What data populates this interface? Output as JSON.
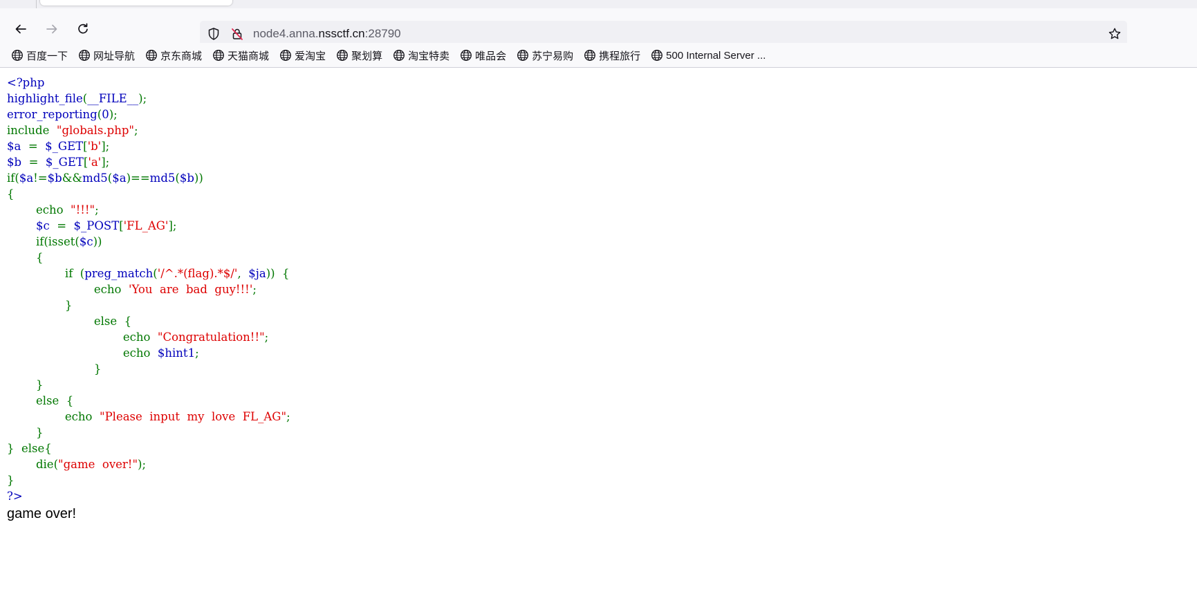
{
  "browser": {
    "url_prefix": "node4.anna.",
    "url_domain": "nssctf.cn",
    "url_suffix": ":28790",
    "icons": {
      "back": "arrow-left-icon",
      "forward": "arrow-right-icon",
      "reload": "reload-icon",
      "tracking": "shield-icon",
      "insecure": "insecure-lock-icon",
      "bookmark": "star-icon",
      "bookmark_item": "globe-icon"
    },
    "bookmarks": [
      "百度一下",
      "网址导航",
      "京东商城",
      "天猫商城",
      "爱淘宝",
      "聚划算",
      "淘宝特卖",
      "唯品会",
      "苏宁易购",
      "携程旅行",
      "500 Internal Server ..."
    ]
  },
  "colors": {
    "php_keyword": "#007700",
    "php_default": "#0000bb",
    "php_string": "#dd0000"
  },
  "code": [
    [
      [
        "d",
        "<?php"
      ]
    ],
    [
      [
        "d",
        "highlight_file"
      ],
      [
        "k",
        "("
      ],
      [
        "d",
        "__FILE__"
      ],
      [
        "k",
        ");"
      ]
    ],
    [
      [
        "d",
        "error_reporting"
      ],
      [
        "k",
        "("
      ],
      [
        "d",
        "0"
      ],
      [
        "k",
        ");"
      ]
    ],
    [
      [
        "k",
        "include  "
      ],
      [
        "s",
        "\"globals.php\""
      ],
      [
        "k",
        ";"
      ]
    ],
    [
      [
        "d",
        "$a  "
      ],
      [
        "k",
        "=  "
      ],
      [
        "d",
        "$_GET"
      ],
      [
        "k",
        "["
      ],
      [
        "s",
        "'b'"
      ],
      [
        "k",
        "];"
      ]
    ],
    [
      [
        "d",
        "$b  "
      ],
      [
        "k",
        "=  "
      ],
      [
        "d",
        "$_GET"
      ],
      [
        "k",
        "["
      ],
      [
        "s",
        "'a'"
      ],
      [
        "k",
        "];"
      ]
    ],
    [
      [
        "k",
        "if("
      ],
      [
        "d",
        "$a"
      ],
      [
        "k",
        "!="
      ],
      [
        "d",
        "$b"
      ],
      [
        "k",
        "&&"
      ],
      [
        "d",
        "md5"
      ],
      [
        "k",
        "("
      ],
      [
        "d",
        "$a"
      ],
      [
        "k",
        ")=="
      ],
      [
        "d",
        "md5"
      ],
      [
        "k",
        "("
      ],
      [
        "d",
        "$b"
      ],
      [
        "k",
        "))"
      ]
    ],
    [
      [
        "k",
        "{"
      ]
    ],
    [
      [
        "k",
        "        echo  "
      ],
      [
        "s",
        "\"!!!\""
      ],
      [
        "k",
        ";"
      ]
    ],
    [
      [
        "d",
        "        $c  "
      ],
      [
        "k",
        "=  "
      ],
      [
        "d",
        "$_POST"
      ],
      [
        "k",
        "["
      ],
      [
        "s",
        "'FL_AG'"
      ],
      [
        "k",
        "];"
      ]
    ],
    [
      [
        "k",
        "        if(isset("
      ],
      [
        "d",
        "$c"
      ],
      [
        "k",
        "))"
      ]
    ],
    [
      [
        "k",
        "        {"
      ]
    ],
    [
      [
        "k",
        "                if  ("
      ],
      [
        "d",
        "preg_match"
      ],
      [
        "k",
        "("
      ],
      [
        "s",
        "'/^.*(flag).*$/'"
      ],
      [
        "k",
        ",  "
      ],
      [
        "d",
        "$ja"
      ],
      [
        "k",
        "))  {"
      ]
    ],
    [
      [
        "k",
        "                        echo  "
      ],
      [
        "s",
        "'You  are  bad  guy!!!'"
      ],
      [
        "k",
        ";"
      ]
    ],
    [
      [
        "k",
        "                }"
      ]
    ],
    [
      [
        "k",
        "                        else  {"
      ]
    ],
    [
      [
        "k",
        "                                echo  "
      ],
      [
        "s",
        "\"Congratulation!!\""
      ],
      [
        "k",
        ";"
      ]
    ],
    [
      [
        "k",
        "                                echo  "
      ],
      [
        "d",
        "$hint1"
      ],
      [
        "k",
        ";"
      ]
    ],
    [
      [
        "k",
        "                        }"
      ]
    ],
    [
      [
        "k",
        "        }"
      ]
    ],
    [
      [
        "k",
        "        else  {"
      ]
    ],
    [
      [
        "k",
        "                echo  "
      ],
      [
        "s",
        "\"Please  input  my  love  FL_AG\""
      ],
      [
        "k",
        ";"
      ]
    ],
    [
      [
        "k",
        "        }"
      ]
    ],
    [
      [
        "k",
        "}  else{"
      ]
    ],
    [
      [
        "k",
        "        die("
      ],
      [
        "s",
        "\"game  over!\""
      ],
      [
        "k",
        ");"
      ]
    ],
    [
      [
        "k",
        "}"
      ]
    ],
    [
      [
        "d",
        "?>"
      ]
    ]
  ],
  "output": "game over!"
}
